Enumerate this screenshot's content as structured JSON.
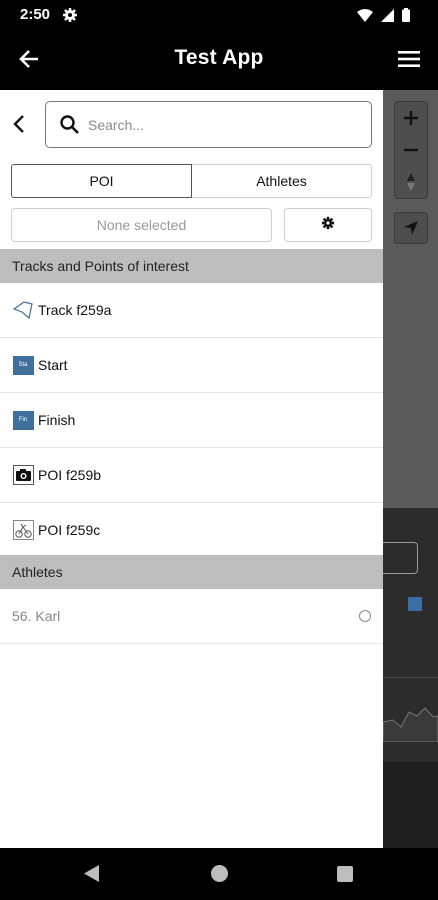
{
  "status_bar": {
    "time": "2:50"
  },
  "app_bar": {
    "title": "Test App"
  },
  "search": {
    "placeholder": "Search..."
  },
  "tabs": [
    {
      "label": "POI"
    },
    {
      "label": "Athletes"
    }
  ],
  "selection": {
    "label": "None selected"
  },
  "sections": {
    "tracks_header": "Tracks and Points of interest",
    "athletes_header": "Athletes"
  },
  "poi_items": [
    {
      "label": "Track f259a",
      "icon": "track-icon"
    },
    {
      "label": "Start",
      "icon": "start-flag-icon",
      "badge": "Sta"
    },
    {
      "label": "Finish",
      "icon": "finish-flag-icon",
      "badge": "Fin"
    },
    {
      "label": "POI f259b",
      "icon": "camera-icon"
    },
    {
      "label": "POI f259c",
      "icon": "bicycle-icon"
    }
  ],
  "athletes": [
    {
      "label": "56. Karl"
    }
  ],
  "colors": {
    "badge_blue": "#3f6f9c",
    "section_grey": "#bdbdbd",
    "map_grey": "#5a5a5a"
  }
}
